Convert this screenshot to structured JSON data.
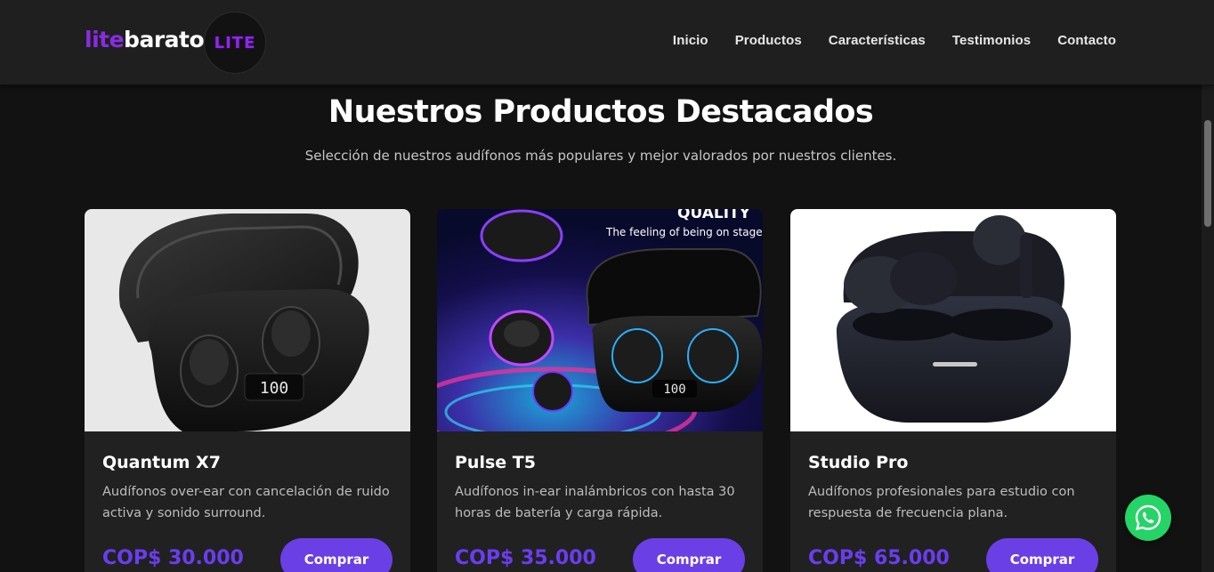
{
  "brand": {
    "part1": "lite",
    "part2": "barato",
    "badge": "LITE",
    "accent": "#8a2be2"
  },
  "nav": [
    "Inicio",
    "Productos",
    "Características",
    "Testimonios",
    "Contacto"
  ],
  "section": {
    "title": "Nuestros Productos Destacados",
    "subtitle": "Selección de nuestros audífonos más populares y mejor valorados por nuestros clientes."
  },
  "products": [
    {
      "name": "Quantum X7",
      "description": "Audífonos over-ear con cancelación de ruido activa y sonido surround.",
      "price": "COP$ 30.000",
      "button": "Comprar",
      "image_display": "100"
    },
    {
      "name": "Pulse T5",
      "description": "Audífonos in-ear inalámbricos con hasta 30 horas de batería y carga rápida.",
      "price": "COP$ 35.000",
      "button": "Comprar",
      "image_display": "100",
      "image_text": "QUALITY",
      "image_tagline": "The feeling of being on stage"
    },
    {
      "name": "Studio Pro",
      "description": "Audífonos profesionales para estudio con respuesta de frecuencia plana.",
      "price": "COP$ 65.000",
      "button": "Comprar"
    }
  ],
  "colors": {
    "button": "#6b3fe6",
    "price": "#6a3df0",
    "whatsapp": "#25d366"
  },
  "icons": {
    "float": "whatsapp-icon"
  }
}
